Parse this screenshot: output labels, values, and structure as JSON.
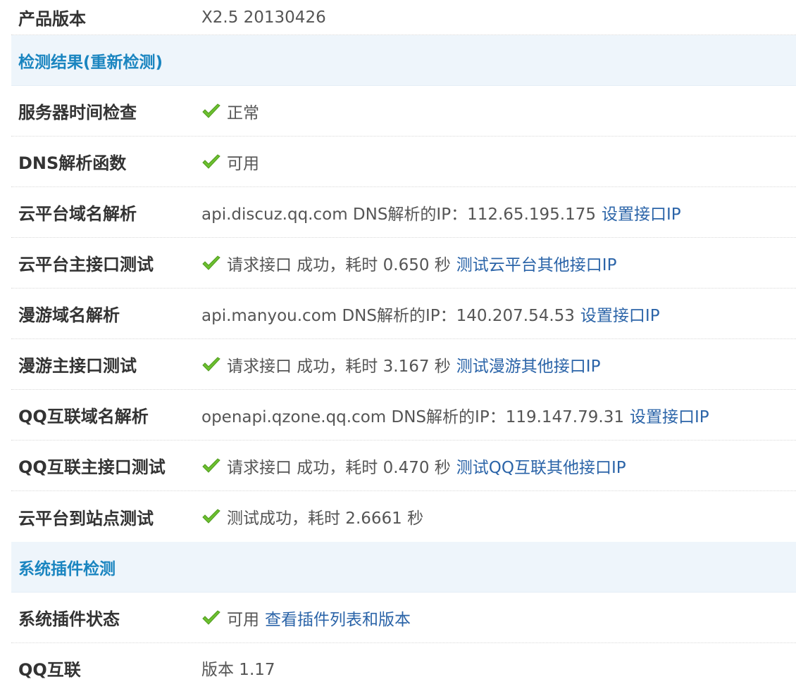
{
  "product": {
    "label": "产品版本",
    "value": "X2.5 20130426"
  },
  "section_detect": {
    "title": "检测结果(重新检测)"
  },
  "rows": {
    "server_time": {
      "label": "服务器时间检查",
      "status": "正常"
    },
    "dns_func": {
      "label": "DNS解析函数",
      "status": "可用"
    },
    "cloud_domain": {
      "label": "云平台域名解析",
      "text": "api.discuz.qq.com DNS解析的IP：112.65.195.175",
      "link": "设置接口IP"
    },
    "cloud_main": {
      "label": "云平台主接口测试",
      "text": "请求接口 成功，耗时 0.650 秒",
      "link": "测试云平台其他接口IP"
    },
    "manyou_domain": {
      "label": "漫游域名解析",
      "text": "api.manyou.com DNS解析的IP：140.207.54.53",
      "link": "设置接口IP"
    },
    "manyou_main": {
      "label": "漫游主接口测试",
      "text": "请求接口 成功，耗时 3.167 秒",
      "link": "测试漫游其他接口IP"
    },
    "qq_domain": {
      "label": "QQ互联域名解析",
      "text": "openapi.qzone.qq.com DNS解析的IP：119.147.79.31",
      "link": "设置接口IP"
    },
    "qq_main": {
      "label": "QQ互联主接口测试",
      "text": "请求接口 成功，耗时 0.470 秒",
      "link": "测试QQ互联其他接口IP"
    },
    "cloud_site": {
      "label": "云平台到站点测试",
      "text": "测试成功，耗时 2.6661 秒"
    }
  },
  "section_plugin": {
    "title": "系统插件检测"
  },
  "plugin": {
    "status_label": "系统插件状态",
    "status_text": "可用",
    "status_link": "查看插件列表和版本",
    "qq_label": "QQ互联",
    "qq_value": "版本 1.17"
  },
  "icons": {
    "check": "check-icon",
    "check_color": "#6cc02f"
  }
}
